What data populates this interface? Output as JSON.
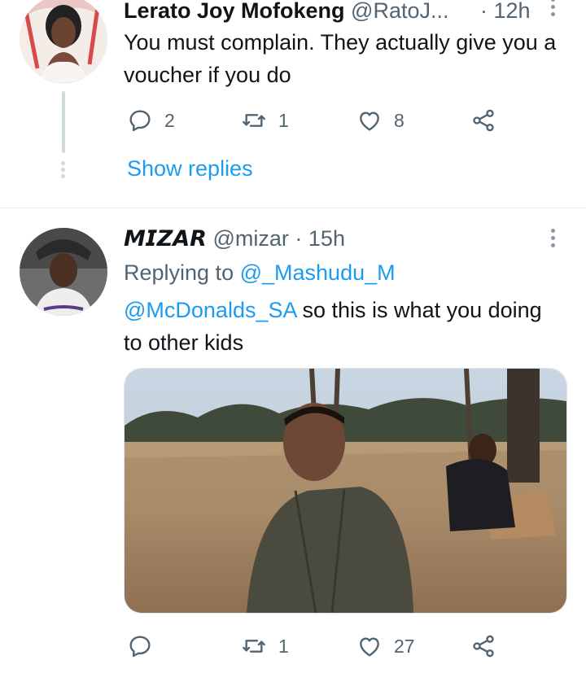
{
  "tweet1": {
    "display_name": "Lerato Joy Mofokeng",
    "handle": "@RatoJ...",
    "time": "· 12h",
    "text": "You must complain. They actually give you a voucher if you do",
    "actions": {
      "replies": "2",
      "retweets": "1",
      "likes": "8"
    },
    "show_replies": "Show replies"
  },
  "tweet2": {
    "display_name": "𝙈𝙄𝙕𝘼𝙍",
    "handle": "@mizar",
    "time": "· 15h",
    "replying_prefix": "Replying to",
    "replying_handle": "@_Mashudu_M",
    "mention": "@McDonalds_SA",
    "text_rest": " so this is what you doing to other kids",
    "actions": {
      "replies": "",
      "retweets": "1",
      "likes": "27"
    }
  },
  "colors": {
    "accent": "#1d9bf0",
    "muted": "#536471",
    "text": "#0f1419"
  },
  "icons": [
    "reply-icon",
    "retweet-icon",
    "like-icon",
    "share-icon",
    "more-icon"
  ]
}
